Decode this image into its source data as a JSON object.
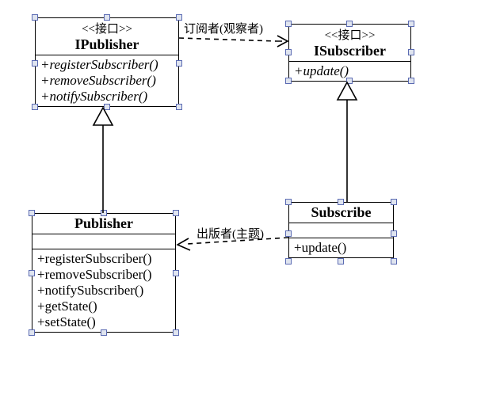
{
  "classes": {
    "ipublisher": {
      "stereotype": "<<接口>>",
      "name": "IPublisher",
      "operations": [
        "+registerSubscriber()",
        "+removeSubscriber()",
        "+notifySubscriber()"
      ]
    },
    "isubscriber": {
      "stereotype": "<<接口>>",
      "name": "ISubscriber",
      "operations": [
        "+update()"
      ]
    },
    "publisher": {
      "name": "Publisher",
      "operations": [
        "+registerSubscriber()",
        "+removeSubscriber()",
        "+notifySubscriber()",
        "+getState()",
        "+setState()"
      ]
    },
    "subscribe": {
      "name": "Subscribe",
      "operations": [
        "+update()"
      ]
    }
  },
  "edges": {
    "dep_ipub_isub_label": "订阅者(观察者)",
    "dep_sub_pub_label": "出版者(主题)"
  },
  "chart_data": {
    "type": "table",
    "description": "UML class diagram (Observer pattern)",
    "nodes": [
      {
        "id": "IPublisher",
        "kind": "interface",
        "stereotype": "<<接口>>",
        "operations": [
          "+registerSubscriber()",
          "+removeSubscriber()",
          "+notifySubscriber()"
        ]
      },
      {
        "id": "ISubscriber",
        "kind": "interface",
        "stereotype": "<<接口>>",
        "operations": [
          "+update()"
        ]
      },
      {
        "id": "Publisher",
        "kind": "class",
        "operations": [
          "+registerSubscriber()",
          "+removeSubscriber()",
          "+notifySubscriber()",
          "+getState()",
          "+setState()"
        ]
      },
      {
        "id": "Subscribe",
        "kind": "class",
        "operations": [
          "+update()"
        ]
      }
    ],
    "edges": [
      {
        "from": "IPublisher",
        "to": "ISubscriber",
        "type": "dependency",
        "label": "订阅者(观察者)"
      },
      {
        "from": "Publisher",
        "to": "IPublisher",
        "type": "realization"
      },
      {
        "from": "Subscribe",
        "to": "ISubscriber",
        "type": "realization"
      },
      {
        "from": "Subscribe",
        "to": "Publisher",
        "type": "dependency",
        "label": "出版者(主题)"
      }
    ]
  }
}
